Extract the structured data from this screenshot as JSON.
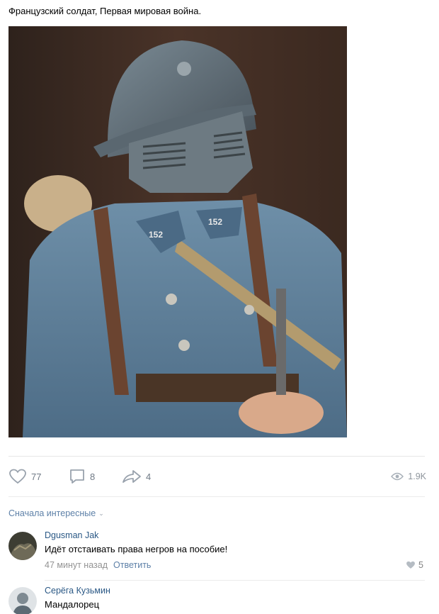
{
  "post": {
    "text": "Французский солдат, Первая мировая война."
  },
  "actions": {
    "likes": "77",
    "comments": "8",
    "shares": "4",
    "views": "1.9K"
  },
  "comments_section": {
    "sort_label": "Сначала интересные"
  },
  "comments": [
    {
      "author": "Dgusman Jak",
      "text": "Идёт отстаивать права негров на пособие!",
      "time": "47 минут назад",
      "reply_label": "Ответить",
      "likes": "5"
    },
    {
      "author": "Серёга Кузьмин",
      "text": "Мандалорец"
    }
  ],
  "colors": {
    "link": "#2a5885",
    "accent": "#5e81a8",
    "muted": "#939393"
  }
}
